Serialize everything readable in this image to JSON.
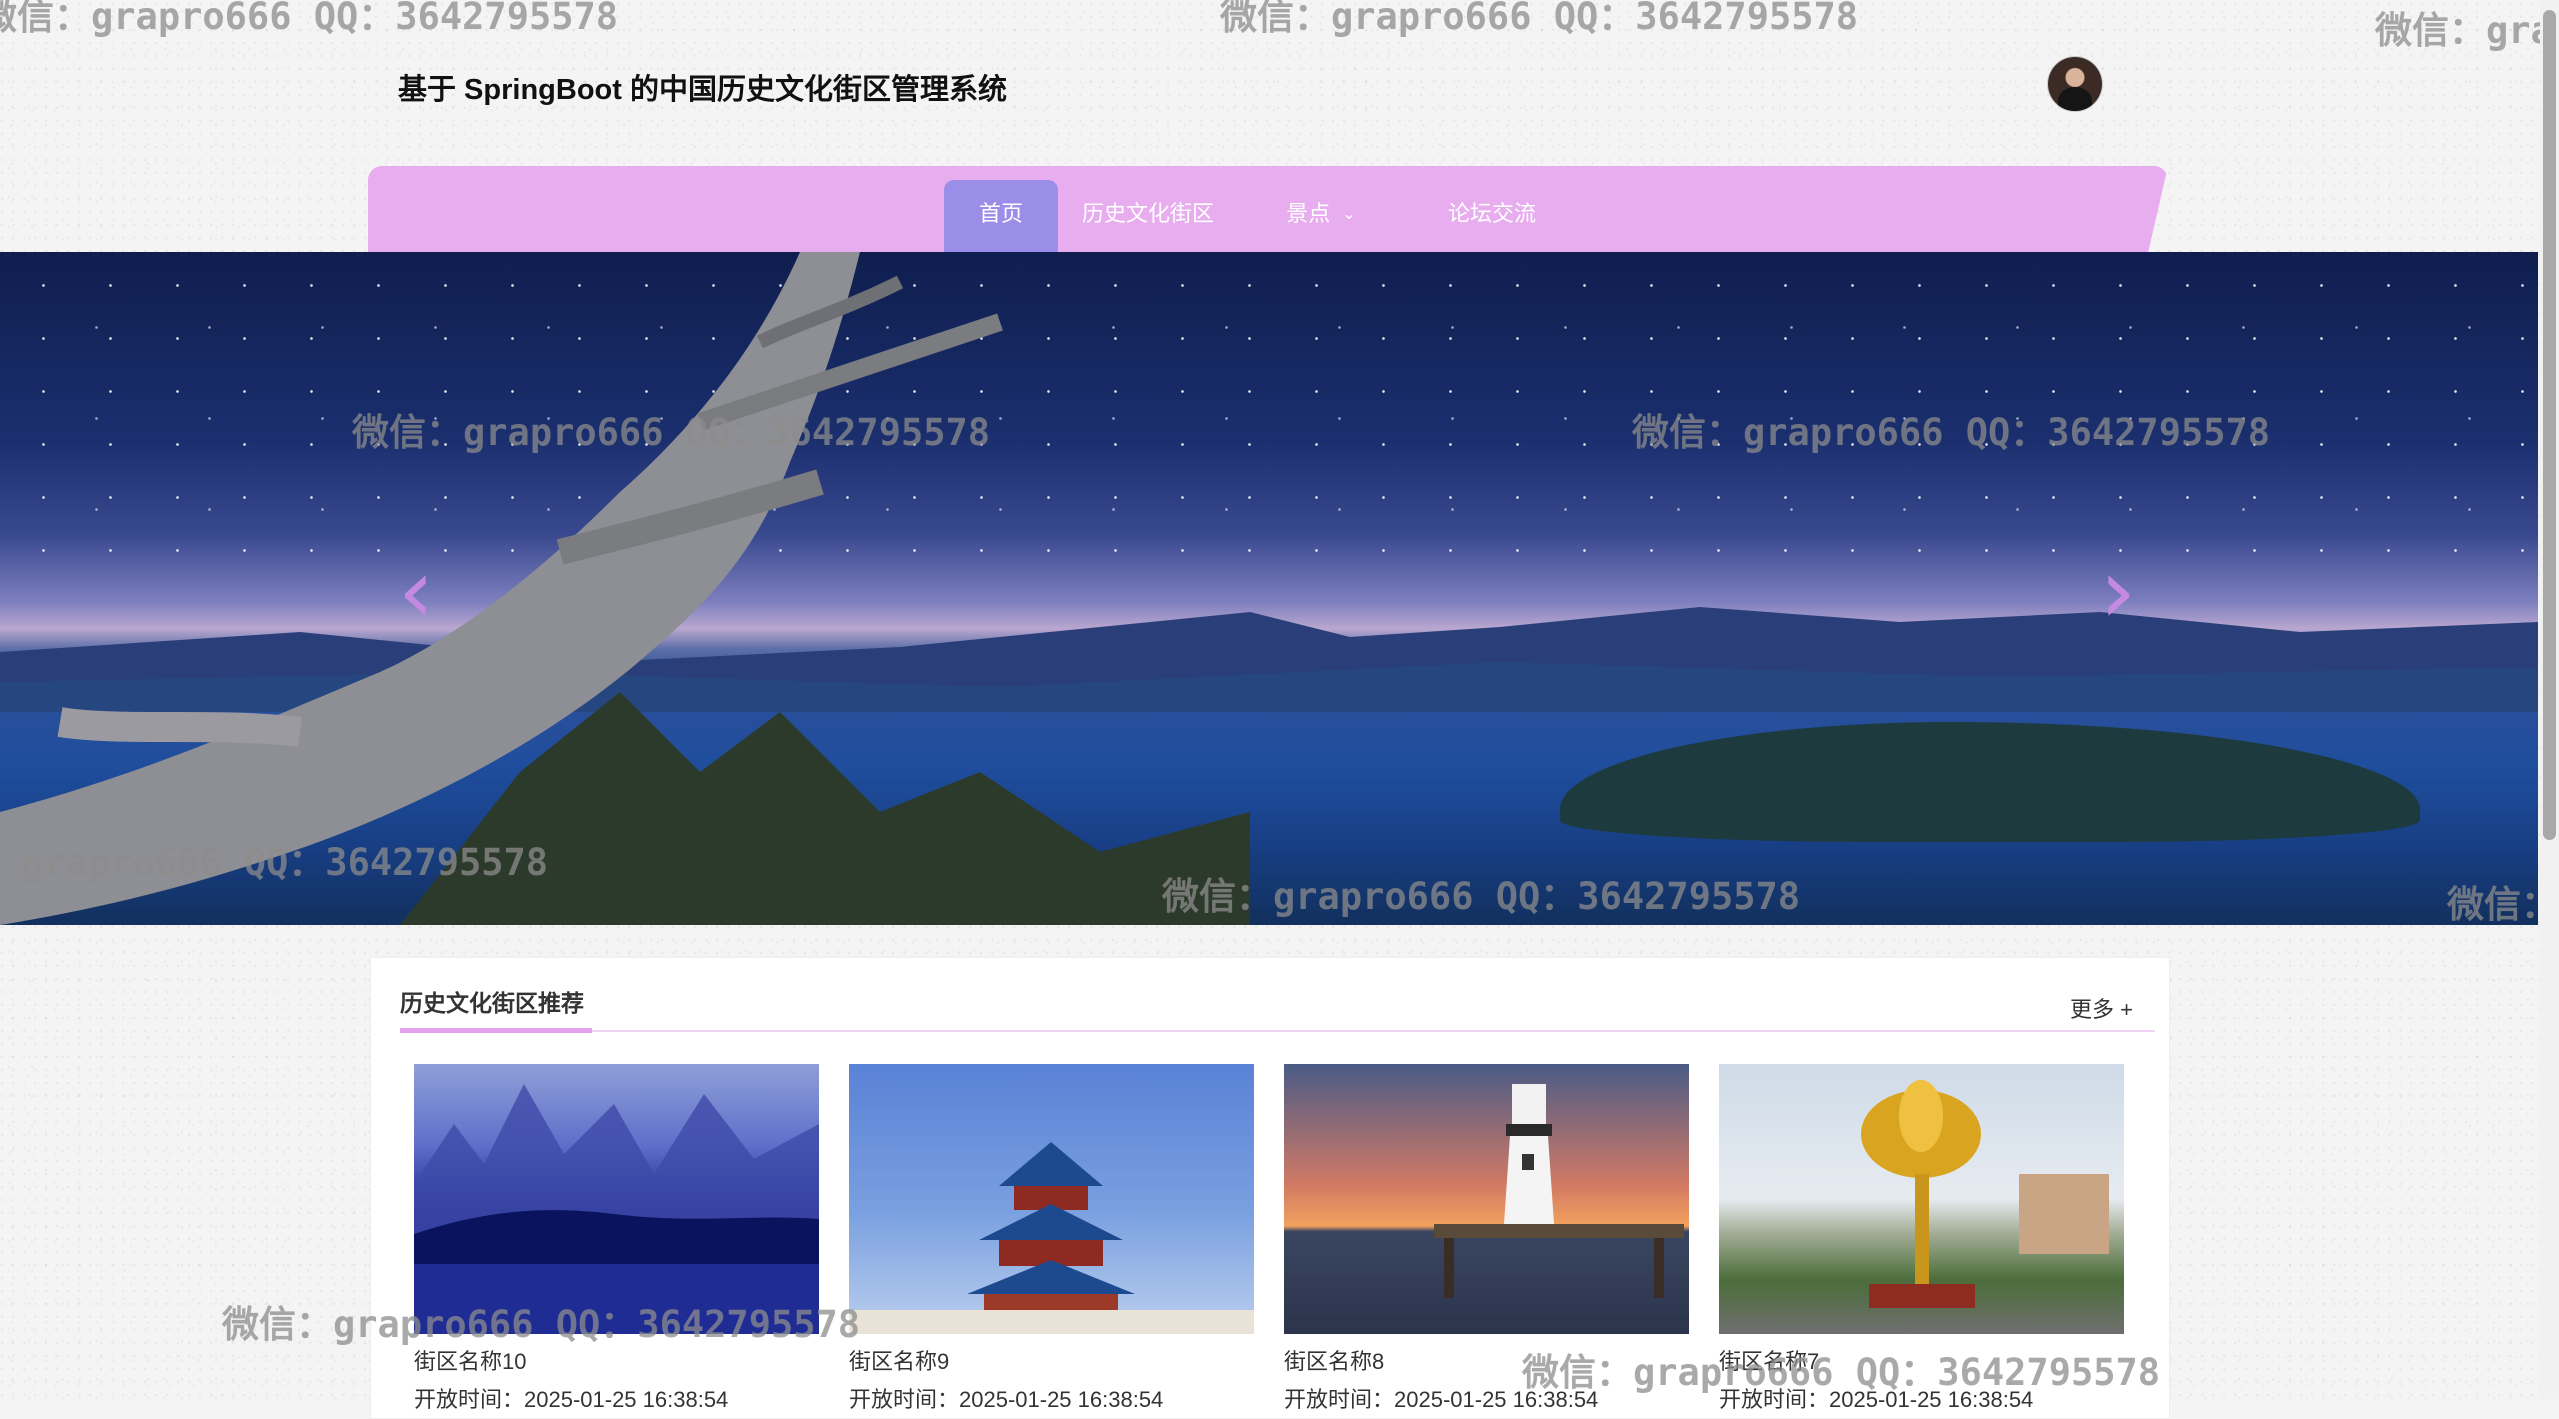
{
  "header": {
    "title": "基于 SpringBoot 的中国历史文化街区管理系统"
  },
  "nav": {
    "items": [
      {
        "label": "首页",
        "active": true
      },
      {
        "label": "历史文化街区",
        "active": false
      },
      {
        "label": "景点",
        "active": false,
        "has_dropdown": true
      },
      {
        "label": "论坛交流",
        "active": false
      }
    ],
    "accent_color": "#e7adef",
    "active_color": "#9b8ee8"
  },
  "banner": {
    "prev_icon": "chevron-left-icon",
    "next_icon": "chevron-right-icon",
    "prev_glyph": "‹",
    "next_glyph": "›"
  },
  "recommend": {
    "title": "历史文化街区推荐",
    "more_label": "更多 +",
    "cards": [
      {
        "name": "街区名称10",
        "time": "开放时间：2025-01-25 16:38:54"
      },
      {
        "name": "街区名称9",
        "time": "开放时间：2025-01-25 16:38:54"
      },
      {
        "name": "街区名称8",
        "time": "开放时间：2025-01-25 16:38:54"
      },
      {
        "name": "街区名称7",
        "time": "开放时间：2025-01-25 16:38:54"
      }
    ]
  },
  "watermark": {
    "text": "微信：grapro666 QQ：3642795578"
  }
}
